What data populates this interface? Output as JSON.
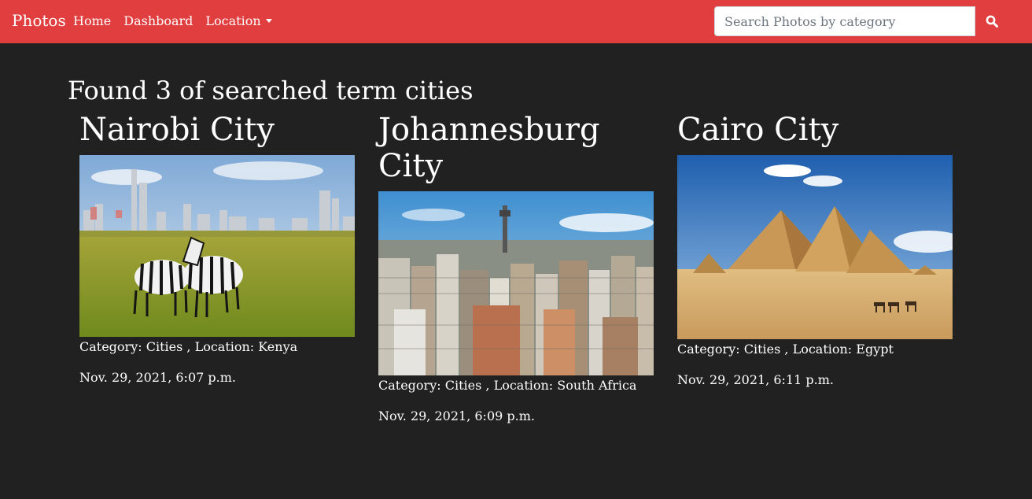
{
  "navbar": {
    "brand": "Photos",
    "links": [
      "Home",
      "Dashboard",
      "Location"
    ],
    "search_placeholder": "Search Photos by category",
    "search_icon": "search-icon",
    "bg_color": "#e03e3f"
  },
  "heading": "Found 3 of searched term cities",
  "cards": [
    {
      "title": "Nairobi City",
      "meta": "Category: Cities , Location: Kenya",
      "date": "Nov. 29, 2021, 6:07 p.m."
    },
    {
      "title": "Johannesburg City",
      "meta": "Category: Cities , Location: South Africa",
      "date": "Nov. 29, 2021, 6:09 p.m."
    },
    {
      "title": "Cairo City",
      "meta": "Category: Cities , Location: Egypt",
      "date": "Nov. 29, 2021, 6:11 p.m."
    }
  ]
}
